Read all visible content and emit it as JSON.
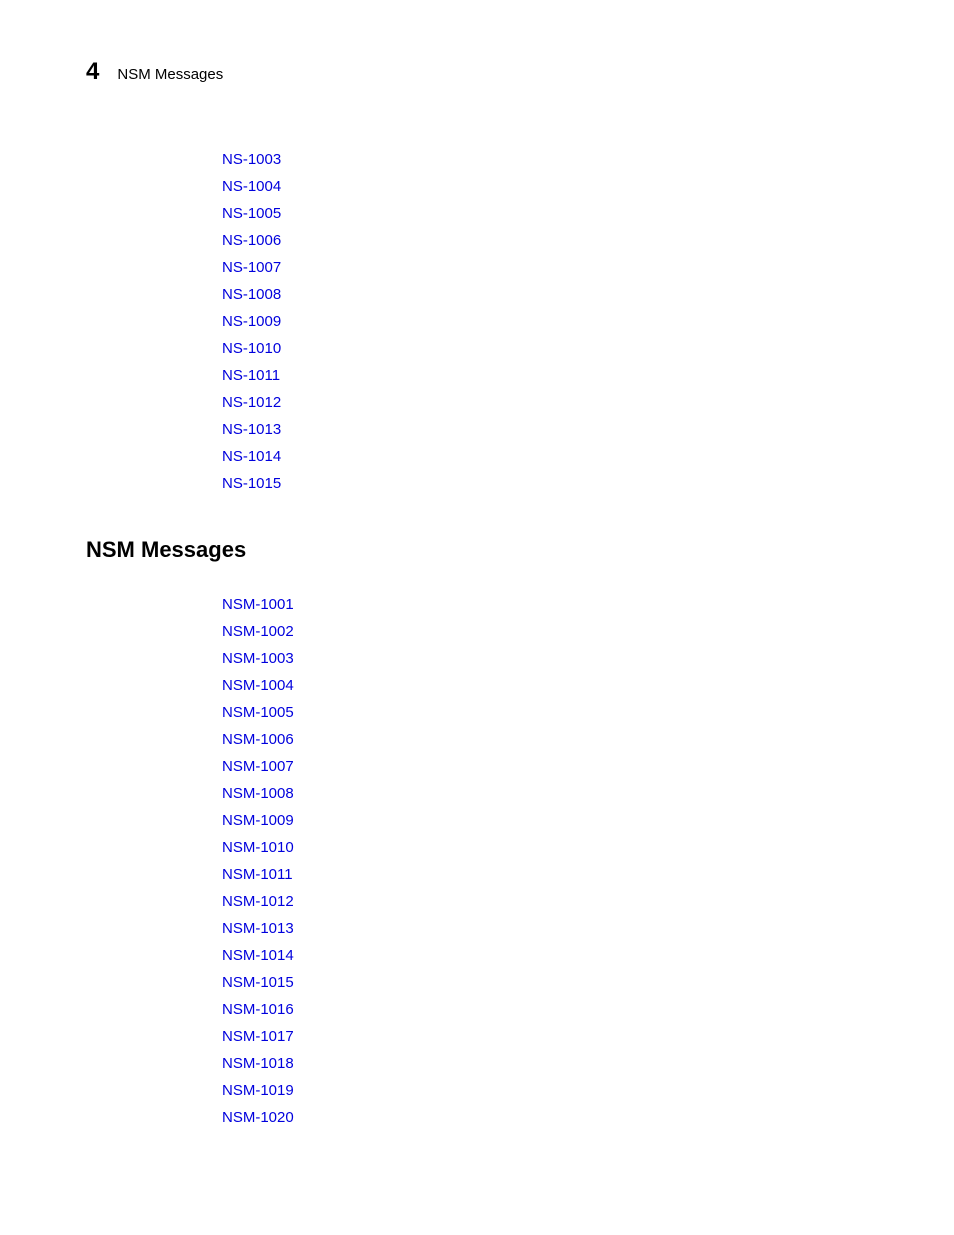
{
  "header": {
    "page_number": "4",
    "title": "NSM Messages"
  },
  "ns_links": [
    "NS-1003",
    "NS-1004",
    "NS-1005",
    "NS-1006",
    "NS-1007",
    "NS-1008",
    "NS-1009",
    "NS-1010",
    "NS-1011",
    "NS-1012",
    "NS-1013",
    "NS-1014",
    "NS-1015"
  ],
  "section_heading": "NSM Messages",
  "nsm_links": [
    "NSM-1001",
    "NSM-1002",
    "NSM-1003",
    "NSM-1004",
    "NSM-1005",
    "NSM-1006",
    "NSM-1007",
    "NSM-1008",
    "NSM-1009",
    "NSM-1010",
    "NSM-1011",
    "NSM-1012",
    "NSM-1013",
    "NSM-1014",
    "NSM-1015",
    "NSM-1016",
    "NSM-1017",
    "NSM-1018",
    "NSM-1019",
    "NSM-1020"
  ]
}
